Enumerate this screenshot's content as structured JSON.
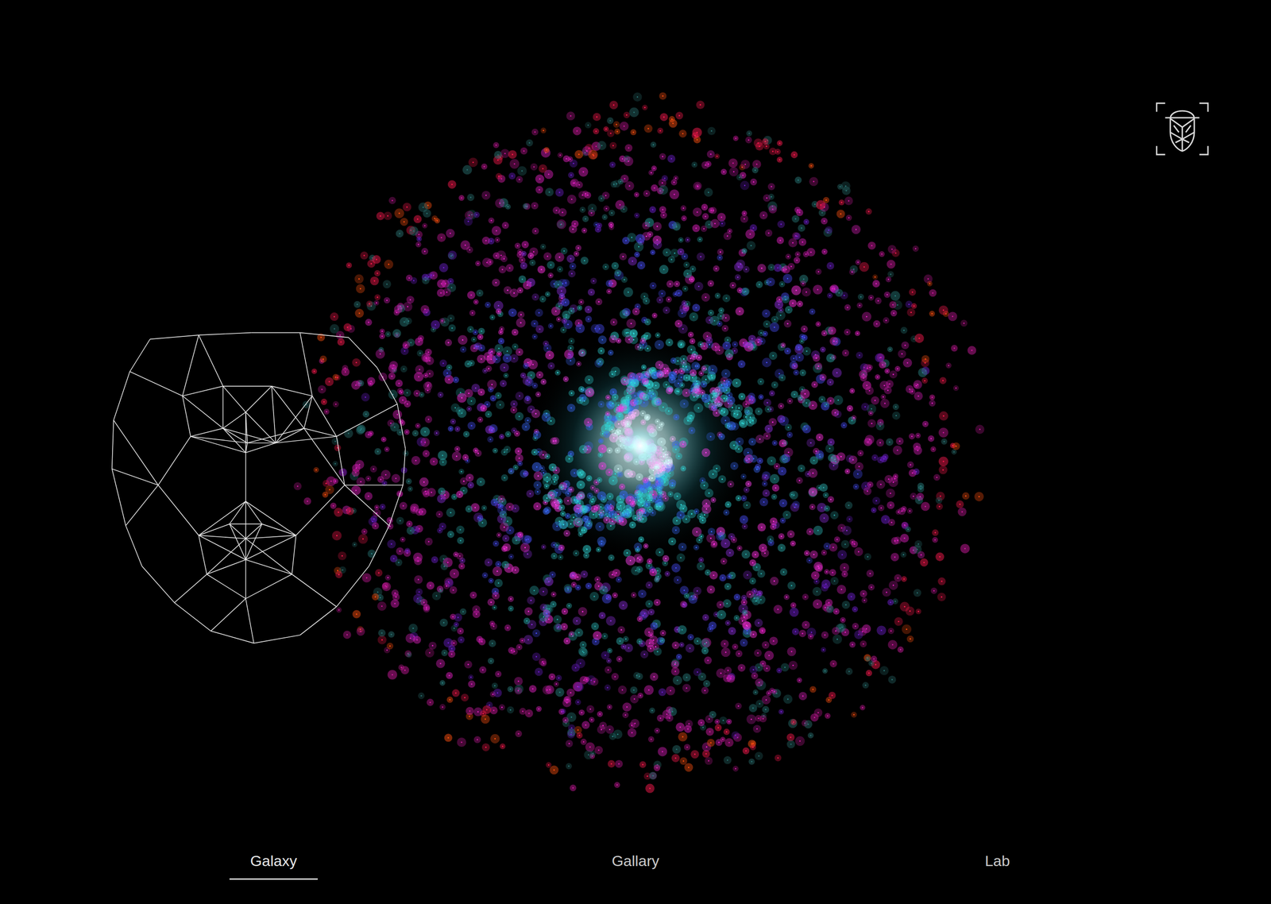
{
  "nav": {
    "tabs": [
      {
        "label": "Galaxy",
        "selected": true
      },
      {
        "label": "Gallary",
        "selected": false
      },
      {
        "label": "Lab",
        "selected": false
      }
    ]
  }
}
